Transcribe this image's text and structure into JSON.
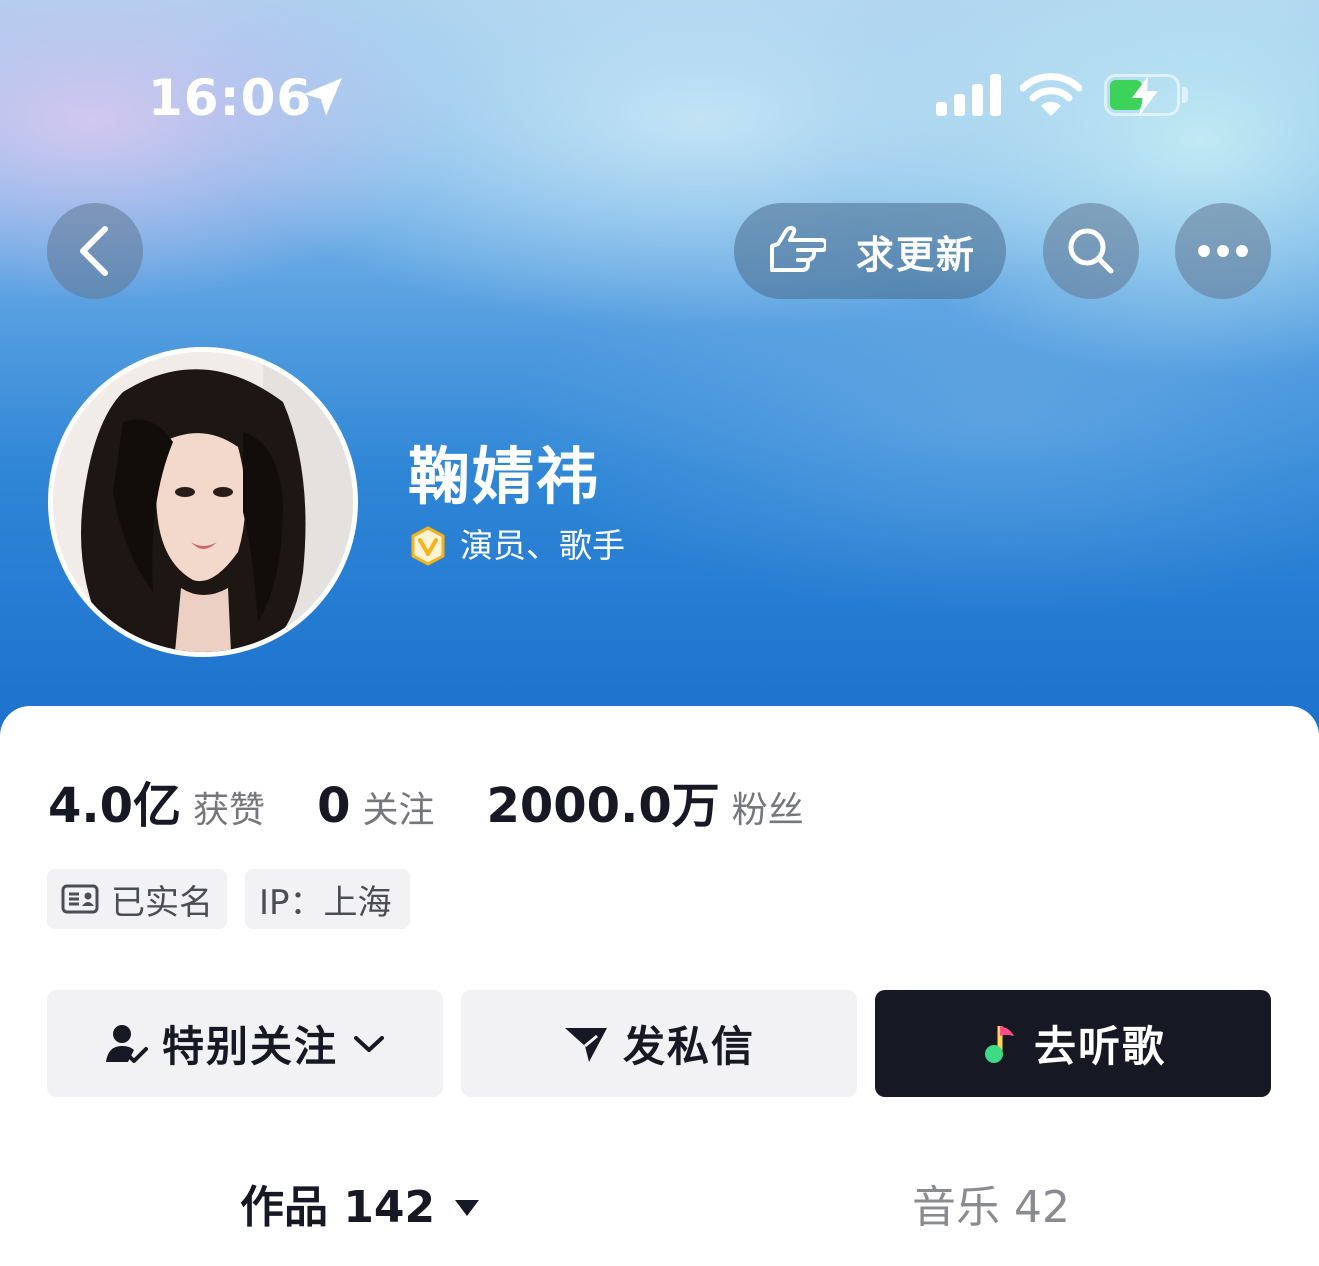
{
  "status_bar": {
    "time": "16:06"
  },
  "top_bar": {
    "update_request_label": "求更新"
  },
  "profile": {
    "name": "鞠婧祎",
    "verified_description": "演员、歌手"
  },
  "stats": [
    {
      "value": "4.0亿",
      "label": "获赞"
    },
    {
      "value": "0",
      "label": "关注"
    },
    {
      "value": "2000.0万",
      "label": "粉丝"
    }
  ],
  "tags": {
    "real_name": "已实名",
    "ip": "IP：上海"
  },
  "actions": {
    "special_follow": "特别关注",
    "send_message": "发私信",
    "listen_music": "去听歌"
  },
  "tabs": [
    {
      "label": "作品 142"
    },
    {
      "label": "音乐 42"
    }
  ],
  "colors": {
    "header_blue": "#2f86d6",
    "dark_button": "#161823",
    "verify_gold": "#f5b31b",
    "music_green": "#3ddc84"
  }
}
